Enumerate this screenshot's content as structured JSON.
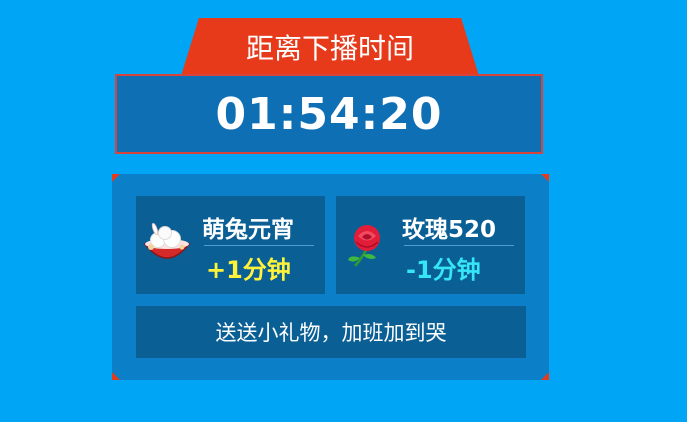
{
  "header": {
    "title": "距离下播时间"
  },
  "countdown": {
    "value": "01:54:20"
  },
  "gifts": [
    {
      "name": "萌兔元宵",
      "effect": "+1分钟",
      "icon": "tangyuan-bowl-icon"
    },
    {
      "name": "玫瑰520",
      "effect": "-1分钟",
      "icon": "rose-icon"
    }
  ],
  "slogan": "送送小礼物，加班加到哭",
  "colors": {
    "background": "#00a6f5",
    "title_tab": "#e63a1b",
    "timer_box": "#0f6fb5",
    "panel": "#0b7fc8",
    "card": "#0a5f95",
    "plus_effect": "#fff23a",
    "minus_effect": "#36e6f6"
  }
}
